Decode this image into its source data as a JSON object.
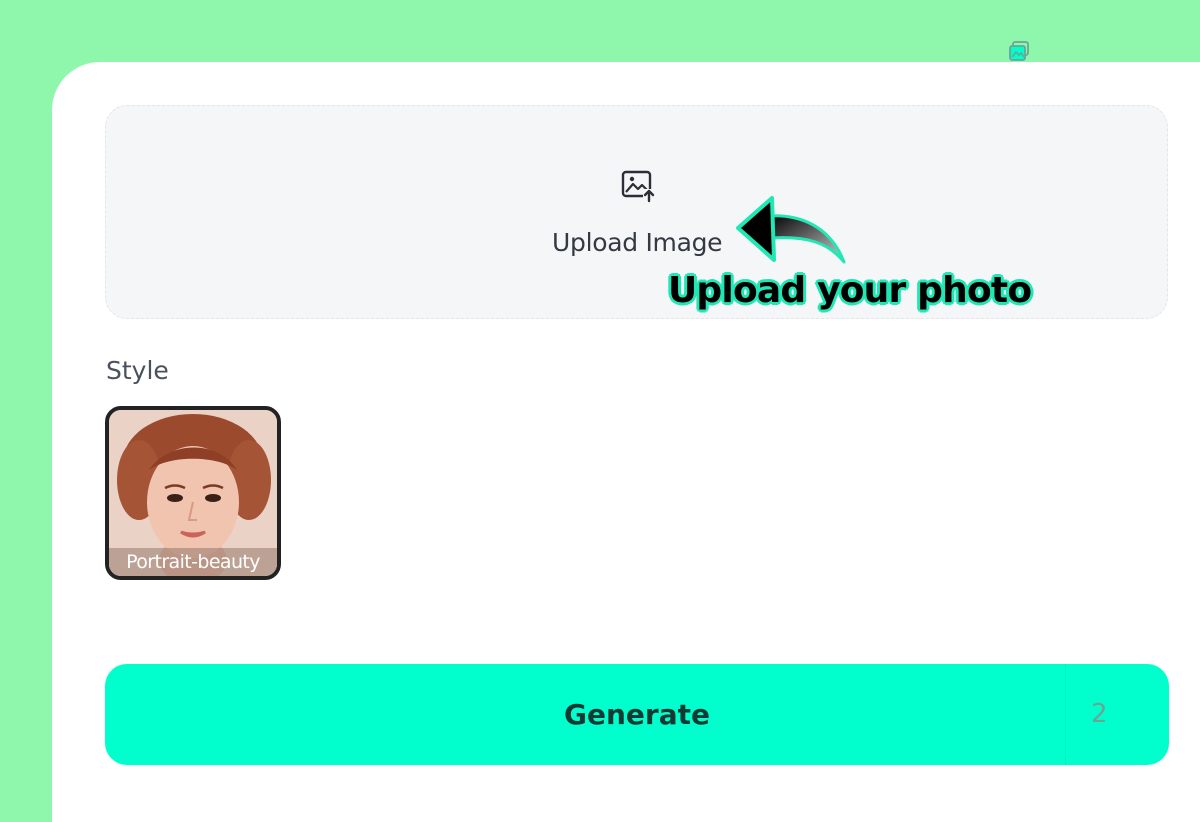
{
  "upload": {
    "label": "Upload Image",
    "icon": "image-upload-icon"
  },
  "callout": {
    "text": "Upload your photo",
    "color": "#20e7b4"
  },
  "style_section": {
    "title": "Style",
    "items": [
      {
        "label": "Portrait-beauty",
        "selected": true
      }
    ]
  },
  "generate": {
    "label": "Generate",
    "cost": "2",
    "cost_icon": "images-icon",
    "color": "#00ffcc"
  },
  "colors": {
    "background": "#8ff7ab",
    "accent": "#00ffcc"
  }
}
